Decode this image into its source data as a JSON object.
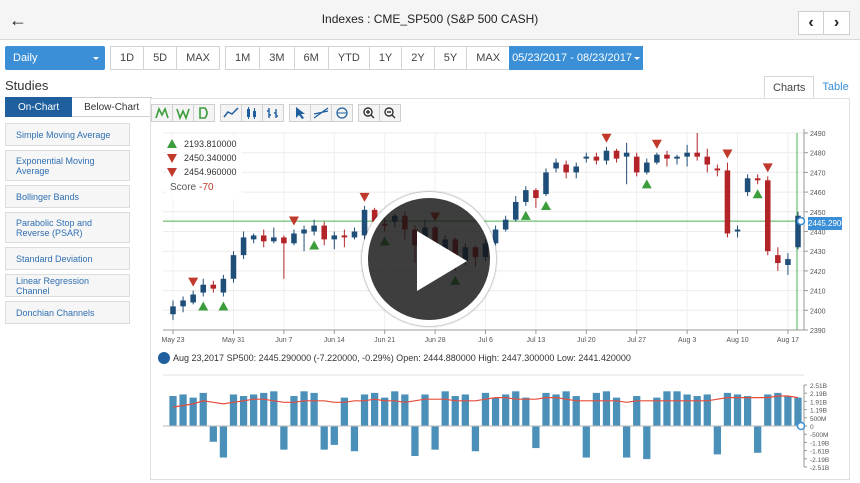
{
  "header": {
    "back_icon": "arrow-left-icon",
    "title": "Indexes : CME_SP500 (S&P 500 CASH)",
    "prev_icon": "chevron-left-icon",
    "next_icon": "chevron-right-icon"
  },
  "toolbar": {
    "period": "Daily",
    "ranges_a": [
      "1D",
      "5D",
      "MAX"
    ],
    "ranges_b": [
      "1M",
      "3M",
      "6M",
      "YTD",
      "1Y",
      "2Y",
      "5Y",
      "MAX"
    ],
    "date_range": "05/23/2017 - 08/23/2017"
  },
  "studies": {
    "title": "Studies",
    "tabs": [
      "On-Chart",
      "Below-Chart"
    ],
    "items": [
      "Simple Moving Average",
      "Exponential Moving Average",
      "Bollinger Bands",
      "Parabolic Stop and Reverse (PSAR)",
      "Standard Deviation",
      "Linear Regression Channel",
      "Donchian Channels"
    ]
  },
  "view_tabs": [
    "Charts",
    "Table"
  ],
  "info": {
    "rows": [
      {
        "icon": "triangle-up-green-icon",
        "value": "2193.810000"
      },
      {
        "icon": "triangle-down-red-icon",
        "value": "2450.340000"
      },
      {
        "icon": "triangle-down-red-icon",
        "value": "2454.960000"
      }
    ],
    "score_label": "Score",
    "score_value": "-70"
  },
  "status": {
    "date": "Aug 23,2017",
    "text": "SP500: 2445.290000 (-7.220000, -0.29%) Open: 2444.880000 High: 2447.300000 Low: 2441.420000"
  },
  "colors": {
    "up": "#1f4e79",
    "down": "#b32428",
    "volume": "#4a90b8",
    "line": "#e74c3c",
    "accent": "#3a8fd6"
  },
  "chart_data": {
    "type": "candlestick",
    "price_axis": {
      "min": 2390,
      "max": 2490,
      "ticks": [
        2390,
        2400,
        2410,
        2420,
        2430,
        2440,
        2450,
        2460,
        2470,
        2480,
        2490
      ]
    },
    "x_labels": [
      "May 23",
      "May 31",
      "Jun 7",
      "Jun 14",
      "Jun 21",
      "Jun 28",
      "Jul 6",
      "Jul 13",
      "Jul 20",
      "Jul 27",
      "Aug 3",
      "Aug 10",
      "Aug 17"
    ],
    "x_label_index": [
      0,
      6,
      11,
      16,
      21,
      26,
      31,
      36,
      41,
      46,
      51,
      56,
      61
    ],
    "last_price_tag": "2445.2900",
    "candles": [
      [
        2398,
        2402,
        2405,
        2395
      ],
      [
        2402,
        2405,
        2407,
        2399
      ],
      [
        2404,
        2408,
        2410,
        2403
      ],
      [
        2409,
        2413,
        2416,
        2407
      ],
      [
        2413,
        2411,
        2415,
        2409
      ],
      [
        2409,
        2416,
        2418,
        2407
      ],
      [
        2416,
        2428,
        2430,
        2414
      ],
      [
        2428,
        2437,
        2440,
        2426
      ],
      [
        2436,
        2438,
        2439,
        2434
      ],
      [
        2438,
        2435,
        2441,
        2432
      ],
      [
        2435,
        2437,
        2442,
        2434
      ],
      [
        2437,
        2434,
        2438,
        2416
      ],
      [
        2434,
        2439,
        2441,
        2433
      ],
      [
        2439,
        2441,
        2443,
        2430
      ],
      [
        2440,
        2443,
        2446,
        2438
      ],
      [
        2443,
        2436,
        2445,
        2433
      ],
      [
        2436,
        2438,
        2440,
        2431
      ],
      [
        2438,
        2437,
        2441,
        2432
      ],
      [
        2437,
        2440,
        2442,
        2436
      ],
      [
        2438,
        2451,
        2453,
        2436
      ],
      [
        2451,
        2445,
        2452,
        2441
      ],
      [
        2444,
        2443,
        2447,
        2440
      ],
      [
        2445,
        2448,
        2449,
        2442
      ],
      [
        2448,
        2441,
        2450,
        2436
      ],
      [
        2441,
        2433,
        2443,
        2424
      ],
      [
        2433,
        2442,
        2446,
        2430
      ],
      [
        2442,
        2422,
        2443,
        2418
      ],
      [
        2422,
        2436,
        2438,
        2419
      ],
      [
        2436,
        2425,
        2437,
        2420
      ],
      [
        2425,
        2432,
        2434,
        2423
      ],
      [
        2432,
        2427,
        2433,
        2422
      ],
      [
        2427,
        2434,
        2436,
        2425
      ],
      [
        2434,
        2441,
        2443,
        2433
      ],
      [
        2441,
        2446,
        2448,
        2440
      ],
      [
        2446,
        2455,
        2458,
        2445
      ],
      [
        2455,
        2461,
        2463,
        2453
      ],
      [
        2461,
        2457,
        2462,
        2452
      ],
      [
        2459,
        2470,
        2472,
        2458
      ],
      [
        2472,
        2475,
        2477,
        2470
      ],
      [
        2474,
        2470,
        2476,
        2467
      ],
      [
        2470,
        2473,
        2475,
        2467
      ],
      [
        2477,
        2478,
        2480,
        2475
      ],
      [
        2478,
        2476,
        2480,
        2474
      ],
      [
        2476,
        2481,
        2483,
        2474
      ],
      [
        2481,
        2477,
        2482,
        2475
      ],
      [
        2478,
        2480,
        2485,
        2464
      ],
      [
        2478,
        2470,
        2480,
        2468
      ],
      [
        2470,
        2475,
        2477,
        2469
      ],
      [
        2475,
        2479,
        2480,
        2474
      ],
      [
        2479,
        2477,
        2481,
        2473
      ],
      [
        2477,
        2478,
        2479,
        2474
      ],
      [
        2478,
        2480,
        2484,
        2473
      ],
      [
        2480,
        2478,
        2490,
        2476
      ],
      [
        2478,
        2474,
        2482,
        2470
      ],
      [
        2472,
        2471,
        2474,
        2468
      ],
      [
        2471,
        2439,
        2475,
        2437
      ],
      [
        2440,
        2441,
        2443,
        2437
      ],
      [
        2460,
        2467,
        2469,
        2458
      ],
      [
        2467,
        2466,
        2469,
        2464
      ],
      [
        2466,
        2430,
        2468,
        2428
      ],
      [
        2428,
        2424,
        2432,
        2420
      ],
      [
        2423,
        2426,
        2429,
        2418
      ],
      [
        2432,
        2448,
        2450,
        2431
      ]
    ],
    "buy_signals": [
      3,
      5,
      14,
      21,
      28,
      35,
      37,
      47,
      58
    ],
    "sell_signals": [
      2,
      12,
      19,
      26,
      43,
      48,
      55,
      59
    ],
    "volume_axis": {
      "ticks": [
        "2.51B",
        "2.19B",
        "1.91B",
        "1.19B",
        "500M",
        "0",
        "-500M",
        "-1.19B",
        "-1.61B",
        "-2.19B",
        "-2.51B"
      ]
    },
    "volume": [
      1.9,
      2.0,
      1.8,
      2.1,
      -1.0,
      -2.0,
      2.0,
      1.9,
      2.0,
      2.1,
      2.2,
      -1.5,
      1.9,
      2.2,
      2.1,
      -1.5,
      -1.2,
      1.8,
      -1.6,
      2.0,
      2.1,
      1.8,
      2.2,
      2.0,
      -1.9,
      2.0,
      -1.5,
      2.2,
      1.9,
      2.0,
      -1.6,
      2.1,
      1.8,
      2.0,
      2.2,
      1.8,
      -1.4,
      2.1,
      2.0,
      2.2,
      1.9,
      -2.0,
      2.1,
      2.2,
      1.8,
      -2.0,
      1.9,
      -2.1,
      1.8,
      2.2,
      2.2,
      2.0,
      1.9,
      2.0,
      -1.8,
      2.1,
      2.0,
      1.9,
      -1.7,
      2.0,
      2.1,
      1.9,
      1.8
    ],
    "volume_ma": [
      1.2,
      1.3,
      1.4,
      1.6,
      1.5,
      1.4,
      1.5,
      1.6,
      1.7,
      1.7,
      1.6,
      1.5,
      1.5,
      1.6,
      1.6,
      1.6,
      1.5,
      1.5,
      1.6,
      1.6,
      1.7,
      1.6,
      1.6,
      1.5,
      1.6,
      1.7,
      1.7,
      1.7,
      1.6,
      1.6,
      1.6,
      1.7,
      1.8,
      1.8,
      1.7,
      1.7,
      1.7,
      1.8,
      1.8,
      1.7,
      1.6,
      1.6,
      1.6,
      1.6,
      1.6,
      1.5,
      1.6,
      1.6,
      1.6,
      1.6,
      1.6,
      1.6,
      1.6,
      1.6,
      1.7,
      1.8,
      1.8,
      1.8,
      1.8,
      1.8,
      1.9,
      1.9,
      1.8
    ]
  },
  "overlay": {
    "play_icon": "play-icon"
  }
}
